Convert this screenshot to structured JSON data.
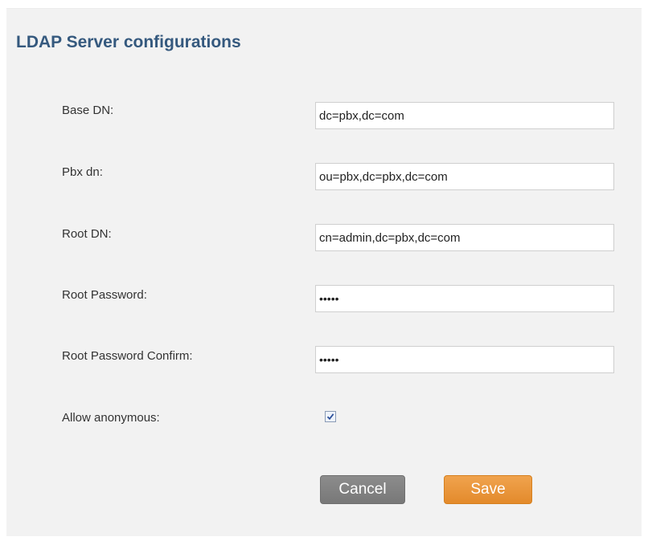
{
  "panel": {
    "title": "LDAP Server configurations"
  },
  "form": {
    "base_dn": {
      "label": "Base DN:",
      "value": "dc=pbx,dc=com"
    },
    "pbx_dn": {
      "label": "Pbx dn:",
      "value": "ou=pbx,dc=pbx,dc=com"
    },
    "root_dn": {
      "label": "Root DN:",
      "value": "cn=admin,dc=pbx,dc=com"
    },
    "root_password": {
      "label": "Root Password:",
      "value": "•••••"
    },
    "root_password_confirm": {
      "label": "Root Password Confirm:",
      "value": "•••••"
    },
    "allow_anonymous": {
      "label": "Allow anonymous:",
      "checked": true
    }
  },
  "buttons": {
    "cancel_label": "Cancel",
    "save_label": "Save"
  },
  "colors": {
    "title": "#35597e",
    "panel_bg": "#f2f2f2",
    "cancel_bg": "#808080",
    "save_bg": "#e9953a"
  }
}
